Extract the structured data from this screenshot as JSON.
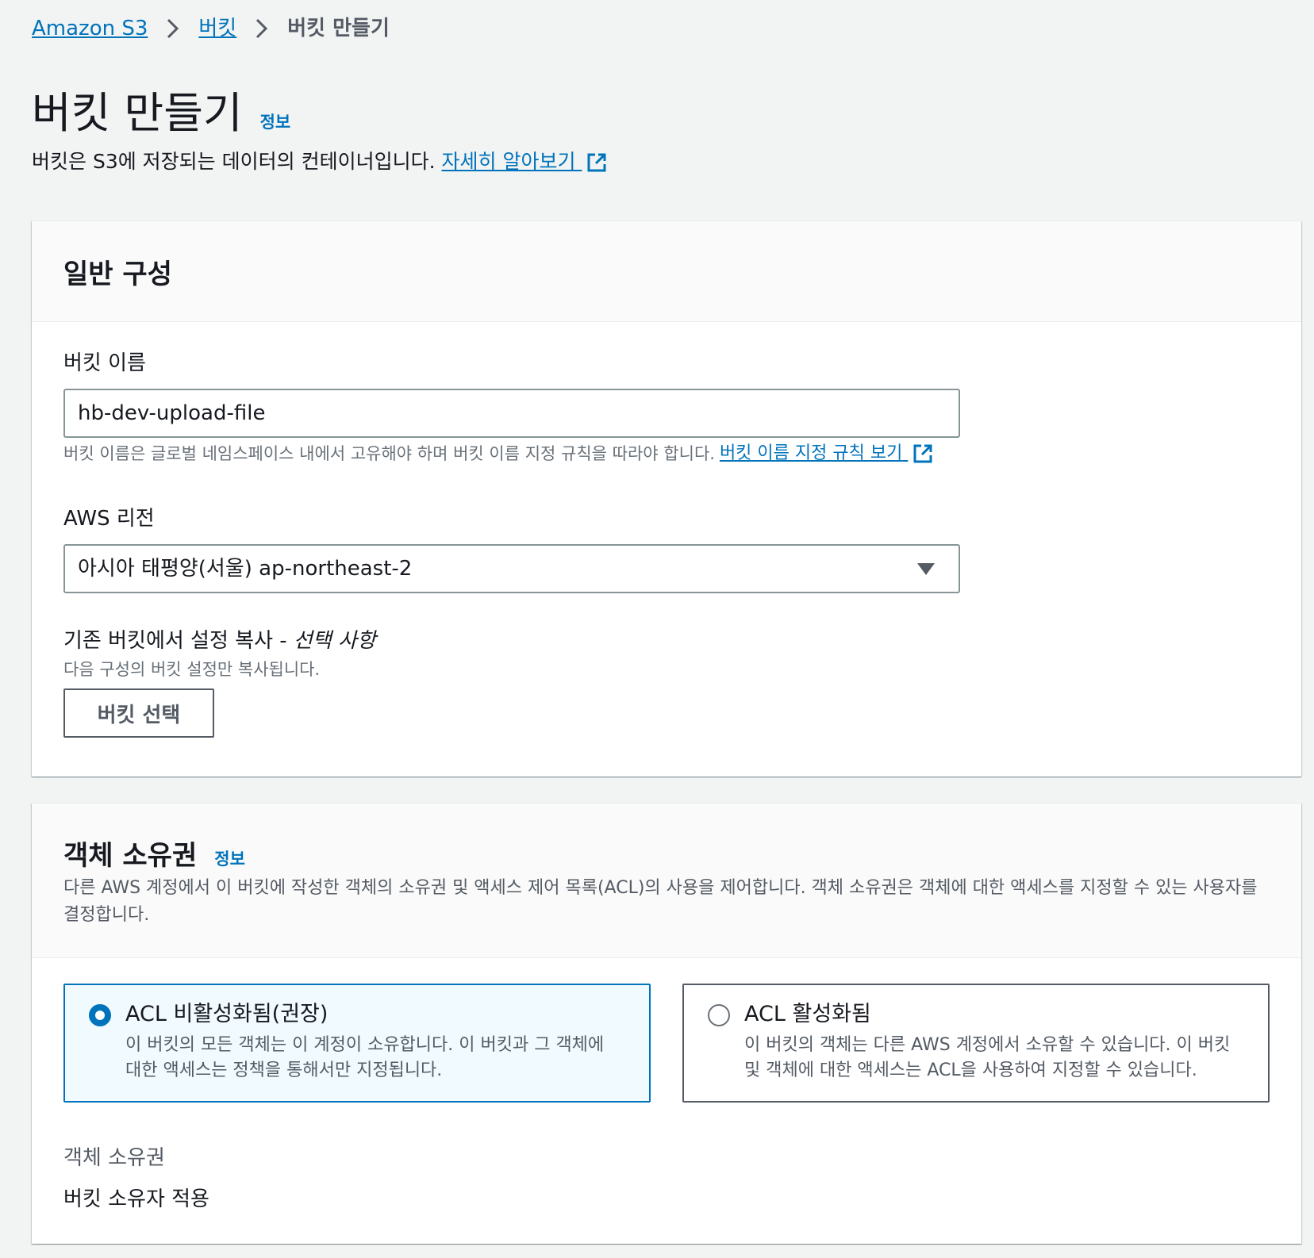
{
  "breadcrumb": {
    "items": [
      "Amazon S3",
      "버킷"
    ],
    "current": "버킷 만들기"
  },
  "header": {
    "title": "버킷 만들기",
    "info": "정보",
    "description": "버킷은 S3에 저장되는 데이터의 컨테이너입니다.",
    "learn_more": "자세히 알아보기"
  },
  "general": {
    "title": "일반 구성",
    "bucket_name_label": "버킷 이름",
    "bucket_name_value": "hb-dev-upload-file",
    "bucket_name_hint": "버킷 이름은 글로벌 네임스페이스 내에서 고유해야 하며 버킷 이름 지정 규칙을 따라야 합니다.",
    "bucket_name_rules_link": "버킷 이름 지정 규칙 보기",
    "region_label": "AWS 리전",
    "region_value": "아시아 태평양(서울) ap-northeast-2",
    "copy_label": "기존 버킷에서 설정 복사 - ",
    "copy_optional": "선택 사항",
    "copy_hint": "다음 구성의 버킷 설정만 복사됩니다.",
    "choose_bucket_button": "버킷 선택"
  },
  "ownership": {
    "title": "객체 소유권",
    "info": "정보",
    "description": "다른 AWS 계정에서 이 버킷에 작성한 객체의 소유권 및 액세스 제어 목록(ACL)의 사용을 제어합니다. 객체 소유권은 객체에 대한 액세스를 지정할 수 있는 사용자를 결정합니다.",
    "options": [
      {
        "title": "ACL 비활성화됨(권장)",
        "description": "이 버킷의 모든 객체는 이 계정이 소유합니다. 이 버킷과 그 객체에 대한 액세스는 정책을 통해서만 지정됩니다.",
        "selected": true
      },
      {
        "title": "ACL 활성화됨",
        "description": "이 버킷의 객체는 다른 AWS 계정에서 소유할 수 있습니다. 이 버킷 및 객체에 대한 액세스는 ACL을 사용하여 지정할 수 있습니다.",
        "selected": false
      }
    ],
    "result_label": "객체 소유권",
    "result_value": "버킷 소유자 적용"
  },
  "colors": {
    "link": "#0073bb",
    "background": "#f2f3f3",
    "selected_tile_bg": "#f1faff",
    "text": "#16191f",
    "secondary_text": "#687078"
  },
  "icons": {
    "breadcrumb_separator": "chevron-right-icon",
    "external_link": "external-link-icon",
    "dropdown": "caret-down-icon",
    "radio": "radio-button-icon"
  }
}
